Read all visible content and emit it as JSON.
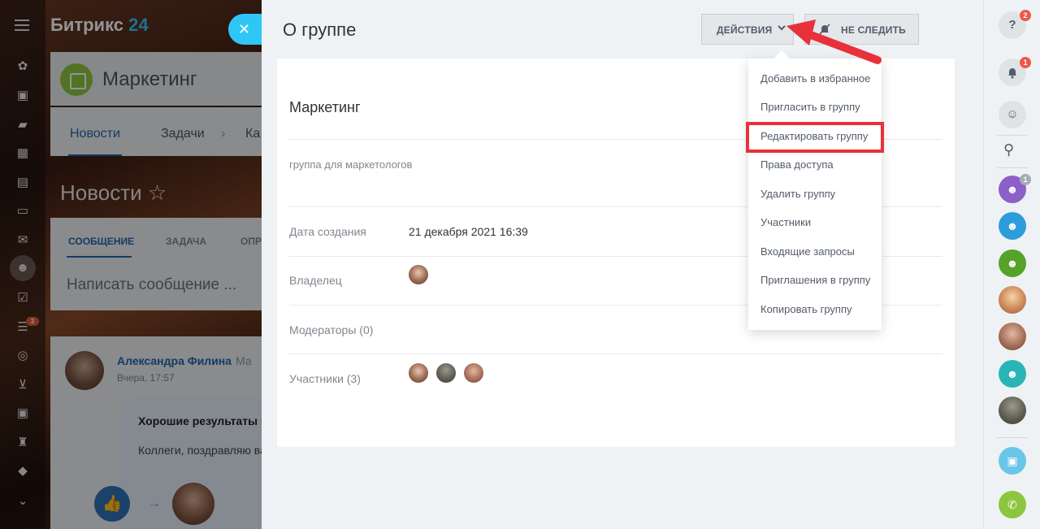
{
  "app": {
    "logo_main": "Битрикс",
    "logo_num": "24"
  },
  "background": {
    "group_name": "Маркетинг",
    "tabs": [
      "Новости",
      "Задачи",
      "Ка"
    ],
    "news_title": "Новости",
    "composer_tabs": [
      "СООБЩЕНИЕ",
      "ЗАДАЧА",
      "ОПР"
    ],
    "composer_placeholder": "Написать сообщение ...",
    "post": {
      "author": "Александра Филина",
      "author_extra": "Ма",
      "time": "Вчера, 17:57",
      "headline": "Хорошие результаты п",
      "text": "Коллеги, поздравляю ва"
    },
    "left_badge": "3"
  },
  "panel": {
    "title": "О группе",
    "actions_label": "ДЕЙСТВИЯ",
    "unfollow_label": "НЕ СЛЕДИТЬ",
    "group_title": "Маркетинг",
    "description": "группа для маркетологов",
    "rows": {
      "created_label": "Дата создания",
      "created_value": "21 декабря 2021 16:39",
      "owner_label": "Владелец",
      "moderators_label": "Модераторы (0)",
      "members_label": "Участники (3)"
    }
  },
  "menu": {
    "items": [
      "Добавить в избранное",
      "Пригласить в группу",
      "Редактировать группу",
      "Права доступа",
      "Удалить группу",
      "Участники",
      "Входящие запросы",
      "Приглашения в группу",
      "Копировать группу"
    ],
    "highlighted_index": 2,
    "highlight_color": "#e8313b"
  },
  "right_bar": {
    "help_badge": "2",
    "notifications_badge": "1",
    "group_badge": "1",
    "accent_colors": [
      "#8d5fc8",
      "#2d9cdb",
      "#55a329",
      "#29b5b5",
      "#a8d84a"
    ]
  }
}
